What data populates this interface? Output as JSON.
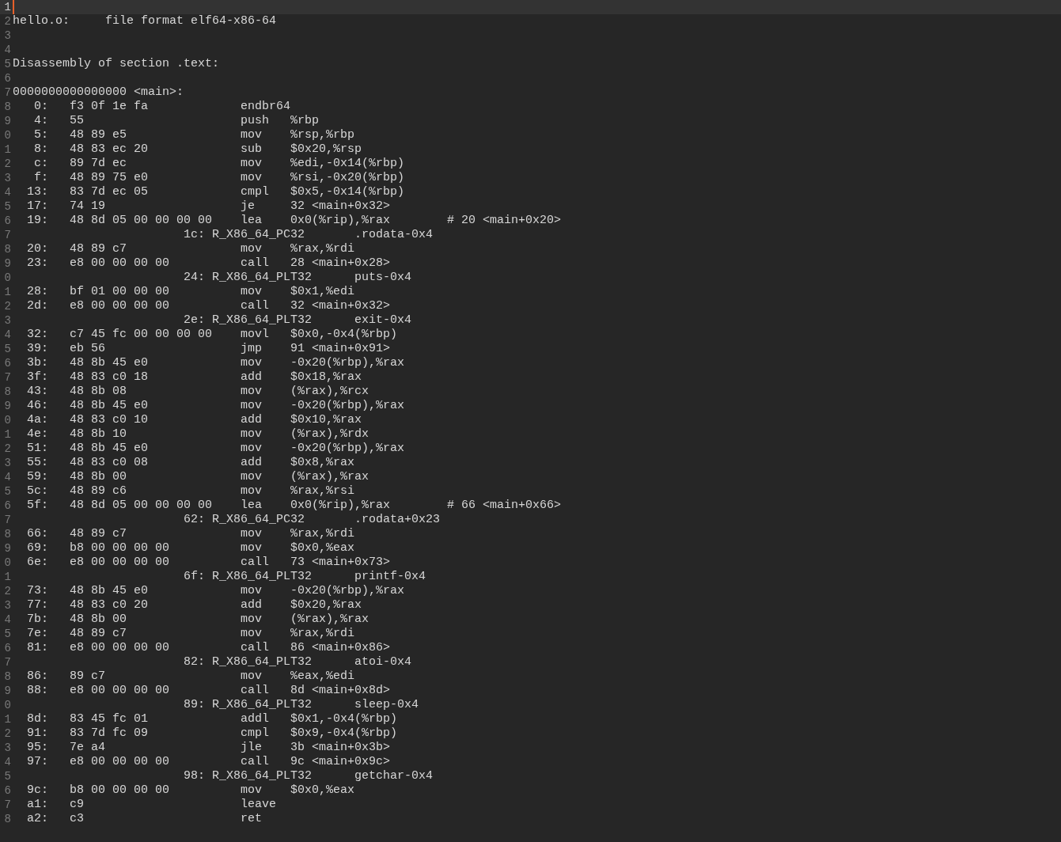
{
  "editor": {
    "lines": [
      {
        "number": "1",
        "kind": "blank",
        "current": true
      },
      {
        "number": "2",
        "kind": "header",
        "file": "hello.o:",
        "format": "file format elf64-x86-64",
        "current": false
      },
      {
        "number": "3",
        "kind": "blank",
        "current": false
      },
      {
        "number": "4",
        "kind": "blank",
        "current": false
      },
      {
        "number": "5",
        "kind": "text",
        "text": "Disassembly of section .text:",
        "current": false
      },
      {
        "number": "6",
        "kind": "blank",
        "current": false
      },
      {
        "number": "7",
        "kind": "text",
        "text": "0000000000000000 <main>:",
        "current": false
      },
      {
        "number": "8",
        "kind": "instruction",
        "address": "0:",
        "bytes": "f3 0f 1e fa",
        "mnemonic": "endbr64",
        "current": false
      },
      {
        "number": "9",
        "kind": "instruction",
        "address": "4:",
        "bytes": "55",
        "mnemonic": "push",
        "operands": "%rbp",
        "current": false
      },
      {
        "number": "0",
        "kind": "instruction",
        "address": "5:",
        "bytes": "48 89 e5",
        "mnemonic": "mov",
        "operands": "%rsp,%rbp",
        "current": false
      },
      {
        "number": "1",
        "kind": "instruction",
        "address": "8:",
        "bytes": "48 83 ec 20",
        "mnemonic": "sub",
        "operands": "$0x20,%rsp",
        "current": false
      },
      {
        "number": "2",
        "kind": "instruction",
        "address": "c:",
        "bytes": "89 7d ec",
        "mnemonic": "mov",
        "operands": "%edi,-0x14(%rbp)",
        "current": false
      },
      {
        "number": "3",
        "kind": "instruction",
        "address": "f:",
        "bytes": "48 89 75 e0",
        "mnemonic": "mov",
        "operands": "%rsi,-0x20(%rbp)",
        "current": false
      },
      {
        "number": "4",
        "kind": "instruction",
        "address": "13:",
        "bytes": "83 7d ec 05",
        "mnemonic": "cmpl",
        "operands": "$0x5,-0x14(%rbp)",
        "current": false
      },
      {
        "number": "5",
        "kind": "instruction",
        "address": "17:",
        "bytes": "74 19",
        "mnemonic": "je",
        "operands": "32 <main+0x32>",
        "current": false
      },
      {
        "number": "6",
        "kind": "instruction",
        "address": "19:",
        "bytes": "48 8d 05 00 00 00 00",
        "mnemonic": "lea",
        "operands": "0x0(%rip),%rax",
        "comment": "# 20 <main+0x20>",
        "current": false
      },
      {
        "number": "7",
        "kind": "relocation",
        "offset": "1c:",
        "type": "R_X86_64_PC32",
        "symbol": ".rodata-0x4",
        "current": false
      },
      {
        "number": "8",
        "kind": "instruction",
        "address": "20:",
        "bytes": "48 89 c7",
        "mnemonic": "mov",
        "operands": "%rax,%rdi",
        "current": false
      },
      {
        "number": "9",
        "kind": "instruction",
        "address": "23:",
        "bytes": "e8 00 00 00 00",
        "mnemonic": "call",
        "operands": "28 <main+0x28>",
        "current": false
      },
      {
        "number": "0",
        "kind": "relocation",
        "offset": "24:",
        "type": "R_X86_64_PLT32",
        "symbol": "puts-0x4",
        "current": false
      },
      {
        "number": "1",
        "kind": "instruction",
        "address": "28:",
        "bytes": "bf 01 00 00 00",
        "mnemonic": "mov",
        "operands": "$0x1,%edi",
        "current": false
      },
      {
        "number": "2",
        "kind": "instruction",
        "address": "2d:",
        "bytes": "e8 00 00 00 00",
        "mnemonic": "call",
        "operands": "32 <main+0x32>",
        "current": false
      },
      {
        "number": "3",
        "kind": "relocation",
        "offset": "2e:",
        "type": "R_X86_64_PLT32",
        "symbol": "exit-0x4",
        "current": false
      },
      {
        "number": "4",
        "kind": "instruction",
        "address": "32:",
        "bytes": "c7 45 fc 00 00 00 00",
        "mnemonic": "movl",
        "operands": "$0x0,-0x4(%rbp)",
        "current": false
      },
      {
        "number": "5",
        "kind": "instruction",
        "address": "39:",
        "bytes": "eb 56",
        "mnemonic": "jmp",
        "operands": "91 <main+0x91>",
        "current": false
      },
      {
        "number": "6",
        "kind": "instruction",
        "address": "3b:",
        "bytes": "48 8b 45 e0",
        "mnemonic": "mov",
        "operands": "-0x20(%rbp),%rax",
        "current": false
      },
      {
        "number": "7",
        "kind": "instruction",
        "address": "3f:",
        "bytes": "48 83 c0 18",
        "mnemonic": "add",
        "operands": "$0x18,%rax",
        "current": false
      },
      {
        "number": "8",
        "kind": "instruction",
        "address": "43:",
        "bytes": "48 8b 08",
        "mnemonic": "mov",
        "operands": "(%rax),%rcx",
        "current": false
      },
      {
        "number": "9",
        "kind": "instruction",
        "address": "46:",
        "bytes": "48 8b 45 e0",
        "mnemonic": "mov",
        "operands": "-0x20(%rbp),%rax",
        "current": false
      },
      {
        "number": "0",
        "kind": "instruction",
        "address": "4a:",
        "bytes": "48 83 c0 10",
        "mnemonic": "add",
        "operands": "$0x10,%rax",
        "current": false
      },
      {
        "number": "1",
        "kind": "instruction",
        "address": "4e:",
        "bytes": "48 8b 10",
        "mnemonic": "mov",
        "operands": "(%rax),%rdx",
        "current": false
      },
      {
        "number": "2",
        "kind": "instruction",
        "address": "51:",
        "bytes": "48 8b 45 e0",
        "mnemonic": "mov",
        "operands": "-0x20(%rbp),%rax",
        "current": false
      },
      {
        "number": "3",
        "kind": "instruction",
        "address": "55:",
        "bytes": "48 83 c0 08",
        "mnemonic": "add",
        "operands": "$0x8,%rax",
        "current": false
      },
      {
        "number": "4",
        "kind": "instruction",
        "address": "59:",
        "bytes": "48 8b 00",
        "mnemonic": "mov",
        "operands": "(%rax),%rax",
        "current": false
      },
      {
        "number": "5",
        "kind": "instruction",
        "address": "5c:",
        "bytes": "48 89 c6",
        "mnemonic": "mov",
        "operands": "%rax,%rsi",
        "current": false
      },
      {
        "number": "6",
        "kind": "instruction",
        "address": "5f:",
        "bytes": "48 8d 05 00 00 00 00",
        "mnemonic": "lea",
        "operands": "0x0(%rip),%rax",
        "comment": "# 66 <main+0x66>",
        "current": false
      },
      {
        "number": "7",
        "kind": "relocation",
        "offset": "62:",
        "type": "R_X86_64_PC32",
        "symbol": ".rodata+0x23",
        "current": false
      },
      {
        "number": "8",
        "kind": "instruction",
        "address": "66:",
        "bytes": "48 89 c7",
        "mnemonic": "mov",
        "operands": "%rax,%rdi",
        "current": false
      },
      {
        "number": "9",
        "kind": "instruction",
        "address": "69:",
        "bytes": "b8 00 00 00 00",
        "mnemonic": "mov",
        "operands": "$0x0,%eax",
        "current": false
      },
      {
        "number": "0",
        "kind": "instruction",
        "address": "6e:",
        "bytes": "e8 00 00 00 00",
        "mnemonic": "call",
        "operands": "73 <main+0x73>",
        "current": false
      },
      {
        "number": "1",
        "kind": "relocation",
        "offset": "6f:",
        "type": "R_X86_64_PLT32",
        "symbol": "printf-0x4",
        "current": false
      },
      {
        "number": "2",
        "kind": "instruction",
        "address": "73:",
        "bytes": "48 8b 45 e0",
        "mnemonic": "mov",
        "operands": "-0x20(%rbp),%rax",
        "current": false
      },
      {
        "number": "3",
        "kind": "instruction",
        "address": "77:",
        "bytes": "48 83 c0 20",
        "mnemonic": "add",
        "operands": "$0x20,%rax",
        "current": false
      },
      {
        "number": "4",
        "kind": "instruction",
        "address": "7b:",
        "bytes": "48 8b 00",
        "mnemonic": "mov",
        "operands": "(%rax),%rax",
        "current": false
      },
      {
        "number": "5",
        "kind": "instruction",
        "address": "7e:",
        "bytes": "48 89 c7",
        "mnemonic": "mov",
        "operands": "%rax,%rdi",
        "current": false
      },
      {
        "number": "6",
        "kind": "instruction",
        "address": "81:",
        "bytes": "e8 00 00 00 00",
        "mnemonic": "call",
        "operands": "86 <main+0x86>",
        "current": false
      },
      {
        "number": "7",
        "kind": "relocation",
        "offset": "82:",
        "type": "R_X86_64_PLT32",
        "symbol": "atoi-0x4",
        "current": false
      },
      {
        "number": "8",
        "kind": "instruction",
        "address": "86:",
        "bytes": "89 c7",
        "mnemonic": "mov",
        "operands": "%eax,%edi",
        "current": false
      },
      {
        "number": "9",
        "kind": "instruction",
        "address": "88:",
        "bytes": "e8 00 00 00 00",
        "mnemonic": "call",
        "operands": "8d <main+0x8d>",
        "current": false
      },
      {
        "number": "0",
        "kind": "relocation",
        "offset": "89:",
        "type": "R_X86_64_PLT32",
        "symbol": "sleep-0x4",
        "current": false
      },
      {
        "number": "1",
        "kind": "instruction",
        "address": "8d:",
        "bytes": "83 45 fc 01",
        "mnemonic": "addl",
        "operands": "$0x1,-0x4(%rbp)",
        "current": false
      },
      {
        "number": "2",
        "kind": "instruction",
        "address": "91:",
        "bytes": "83 7d fc 09",
        "mnemonic": "cmpl",
        "operands": "$0x9,-0x4(%rbp)",
        "current": false
      },
      {
        "number": "3",
        "kind": "instruction",
        "address": "95:",
        "bytes": "7e a4",
        "mnemonic": "jle",
        "operands": "3b <main+0x3b>",
        "current": false
      },
      {
        "number": "4",
        "kind": "instruction",
        "address": "97:",
        "bytes": "e8 00 00 00 00",
        "mnemonic": "call",
        "operands": "9c <main+0x9c>",
        "current": false
      },
      {
        "number": "5",
        "kind": "relocation",
        "offset": "98:",
        "type": "R_X86_64_PLT32",
        "symbol": "getchar-0x4",
        "current": false
      },
      {
        "number": "6",
        "kind": "instruction",
        "address": "9c:",
        "bytes": "b8 00 00 00 00",
        "mnemonic": "mov",
        "operands": "$0x0,%eax",
        "current": false
      },
      {
        "number": "7",
        "kind": "instruction",
        "address": "a1:",
        "bytes": "c9",
        "mnemonic": "leave",
        "current": false
      },
      {
        "number": "8",
        "kind": "instruction",
        "address": "a2:",
        "bytes": "c3",
        "mnemonic": "ret",
        "current": false
      }
    ]
  }
}
